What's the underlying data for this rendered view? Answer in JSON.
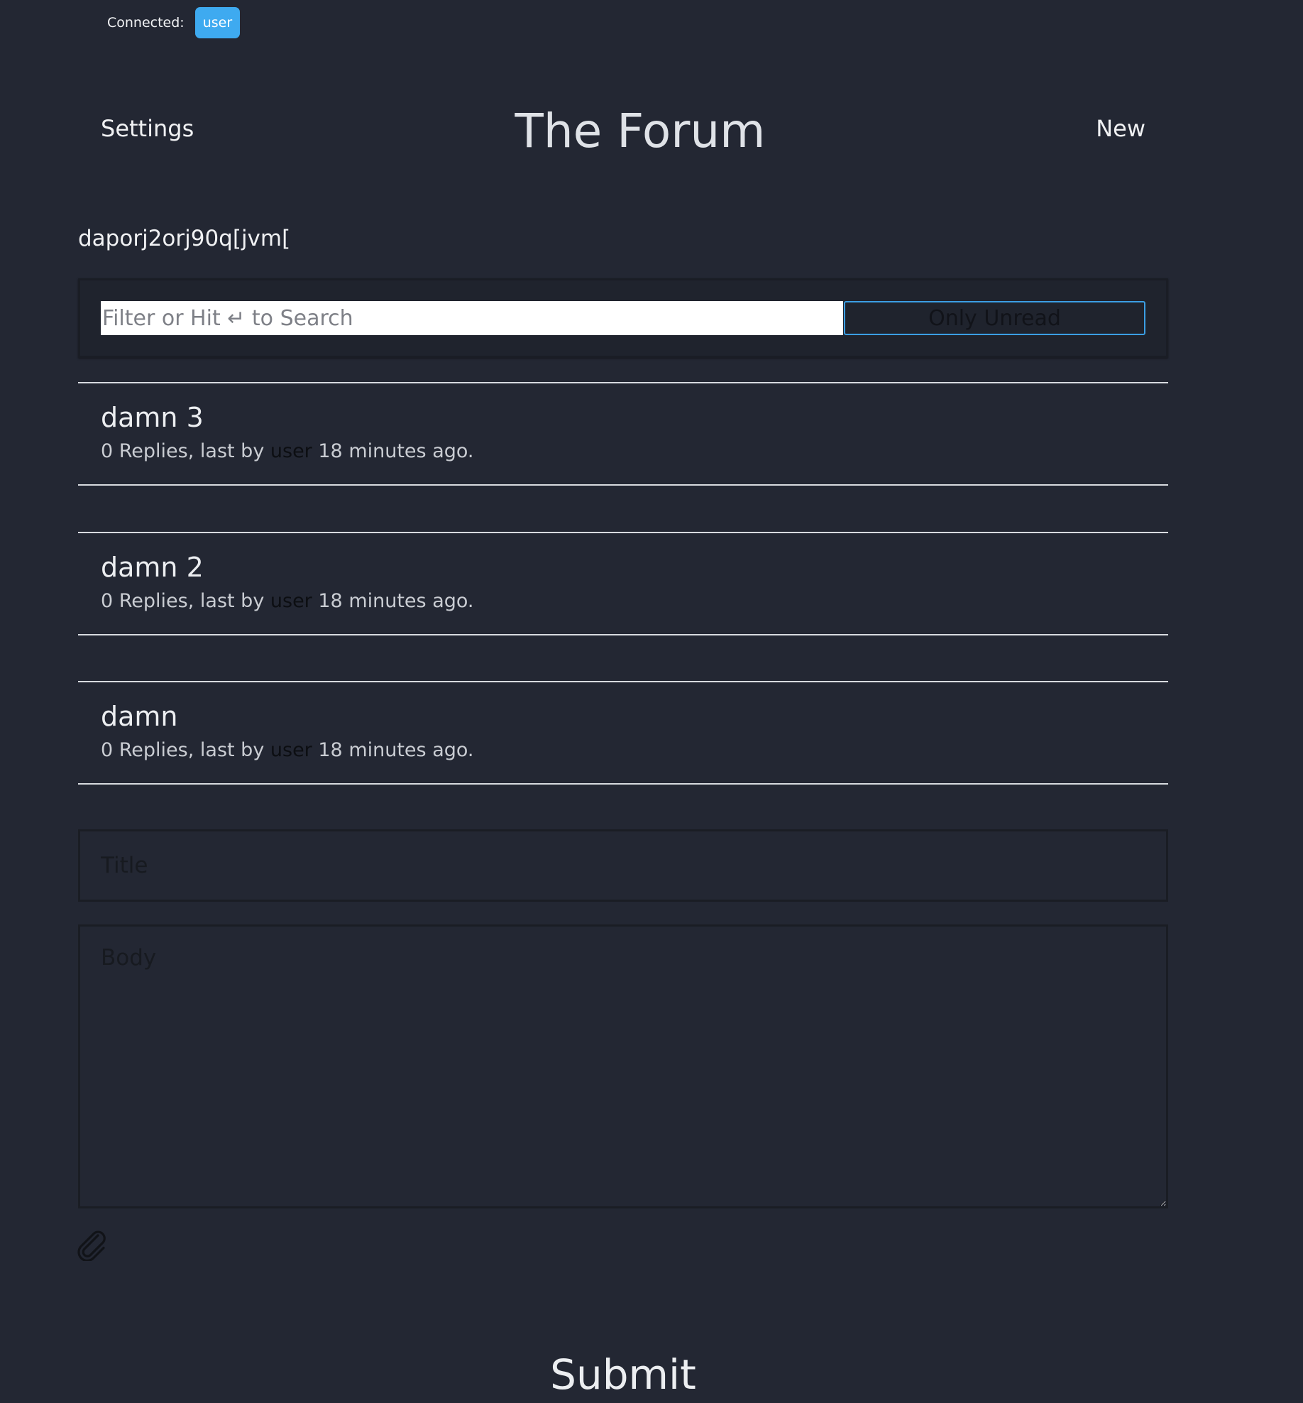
{
  "status": {
    "connected_label": "Connected:",
    "user_badge": "user"
  },
  "header": {
    "settings_label": "Settings",
    "title": "The Forum",
    "new_label": "New"
  },
  "subtitle": "daporj2orj90q[jvm[",
  "filter": {
    "placeholder": "Filter or Hit ↵ to Search",
    "only_unread_label": "Only Unread"
  },
  "threads": [
    {
      "title": "damn 3",
      "replies": "0 Replies, last by ",
      "author": "user",
      "time": " 18 minutes ago."
    },
    {
      "title": "damn 2",
      "replies": "0 Replies, last by ",
      "author": "user",
      "time": " 18 minutes ago."
    },
    {
      "title": "damn",
      "replies": "0 Replies, last by ",
      "author": "user",
      "time": " 18 minutes ago."
    }
  ],
  "compose": {
    "title_placeholder": "Title",
    "body_placeholder": "Body",
    "attach_icon": "paperclip-icon",
    "submit_label": "Submit"
  },
  "colors": {
    "background": "#232733",
    "accent": "#3eaaf0"
  }
}
